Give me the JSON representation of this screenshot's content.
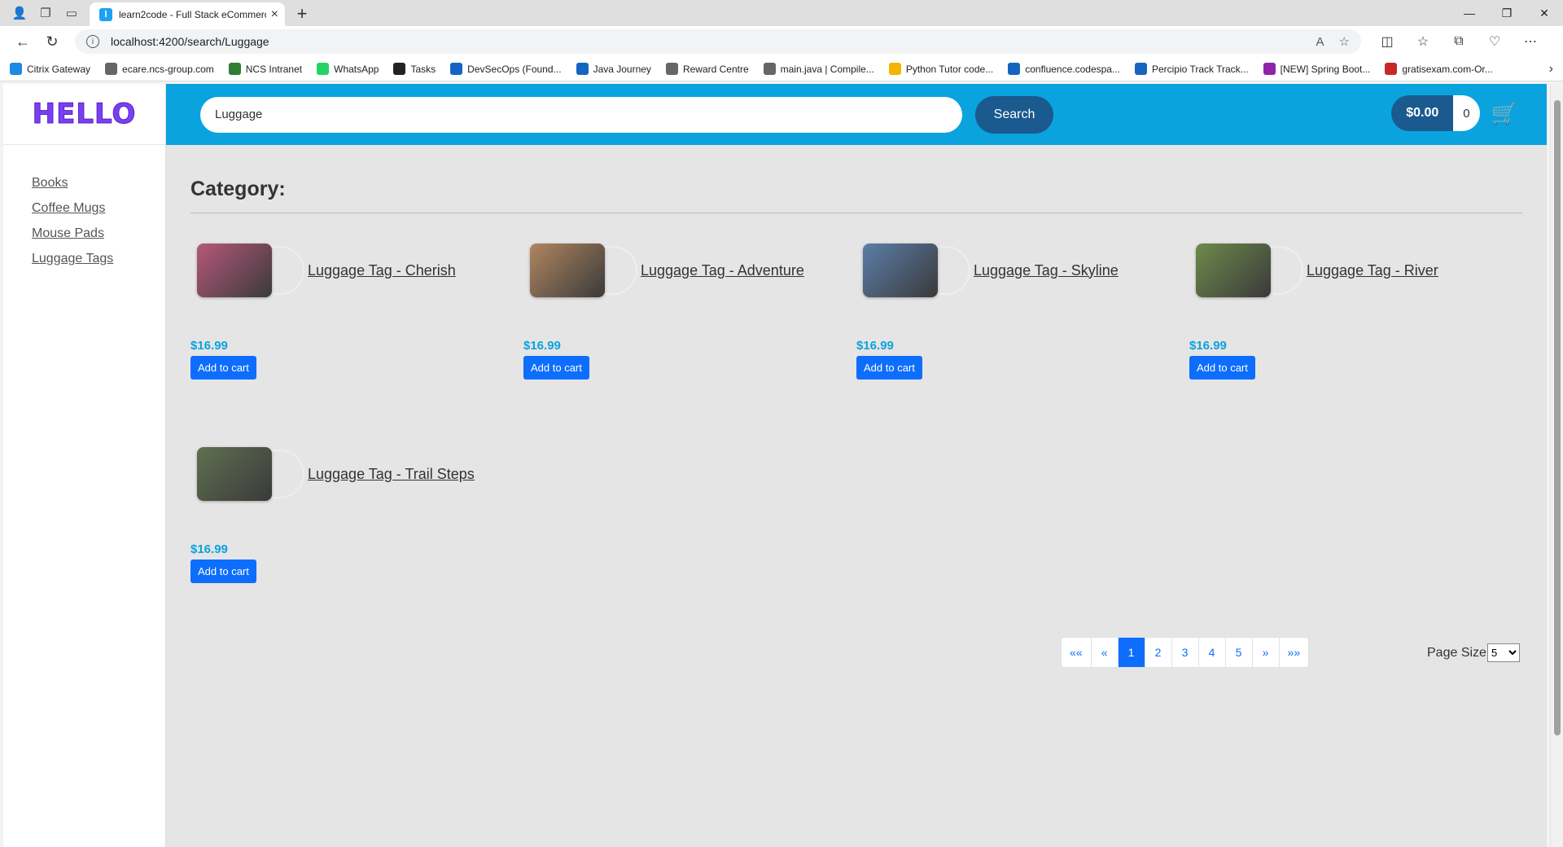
{
  "browser": {
    "tab_title": "learn2code - Full Stack eCommerce",
    "tab_favicon": "l",
    "url": "localhost:4200/search/Luggage",
    "bookmarks": [
      {
        "label": "Citrix Gateway",
        "icon": "#1e88e5"
      },
      {
        "label": "ecare.ncs-group.com",
        "icon": "#666"
      },
      {
        "label": "NCS Intranet",
        "icon": "#2e7d32"
      },
      {
        "label": "WhatsApp",
        "icon": "#25d366"
      },
      {
        "label": "Tasks",
        "icon": "#222"
      },
      {
        "label": "DevSecOps (Found...",
        "icon": "#1565c0"
      },
      {
        "label": "Java Journey",
        "icon": "#1565c0"
      },
      {
        "label": "Reward Centre",
        "icon": "#666"
      },
      {
        "label": "main.java | Compile...",
        "icon": "#666"
      },
      {
        "label": "Python Tutor code...",
        "icon": "#f4b400"
      },
      {
        "label": "confluence.codespa...",
        "icon": "#1565c0"
      },
      {
        "label": "Percipio Track Track...",
        "icon": "#1565c0"
      },
      {
        "label": "[NEW] Spring Boot...",
        "icon": "#8e24aa"
      },
      {
        "label": "gratisexam.com-Or...",
        "icon": "#c62828"
      }
    ]
  },
  "app": {
    "logo": "HELLO",
    "sidebar": [
      "Books",
      "Coffee Mugs",
      "Mouse Pads",
      "Luggage Tags"
    ],
    "search": {
      "value": "Luggage",
      "button": "Search"
    },
    "cart": {
      "total": "$0.00",
      "count": "0",
      "icon": "cart-icon"
    },
    "category_title": "Category:",
    "products": [
      {
        "name": "Luggage Tag - Cherish",
        "price": "$16.99",
        "button": "Add to cart",
        "thumb": "#b5587a"
      },
      {
        "name": "Luggage Tag - Adventure",
        "price": "$16.99",
        "button": "Add to cart",
        "thumb": "#b08660"
      },
      {
        "name": "Luggage Tag - Skyline",
        "price": "$16.99",
        "button": "Add to cart",
        "thumb": "#5b7ea8"
      },
      {
        "name": "Luggage Tag - River",
        "price": "$16.99",
        "button": "Add to cart",
        "thumb": "#6d8a4a"
      },
      {
        "name": "Luggage Tag - Trail Steps",
        "price": "$16.99",
        "button": "Add to cart",
        "thumb": "#5f7050"
      }
    ],
    "pagination": [
      "««",
      "«",
      "1",
      "2",
      "3",
      "4",
      "5",
      "»",
      "»»"
    ],
    "active_page": "1",
    "page_size_label": "Page Size",
    "page_size_value": "5"
  }
}
